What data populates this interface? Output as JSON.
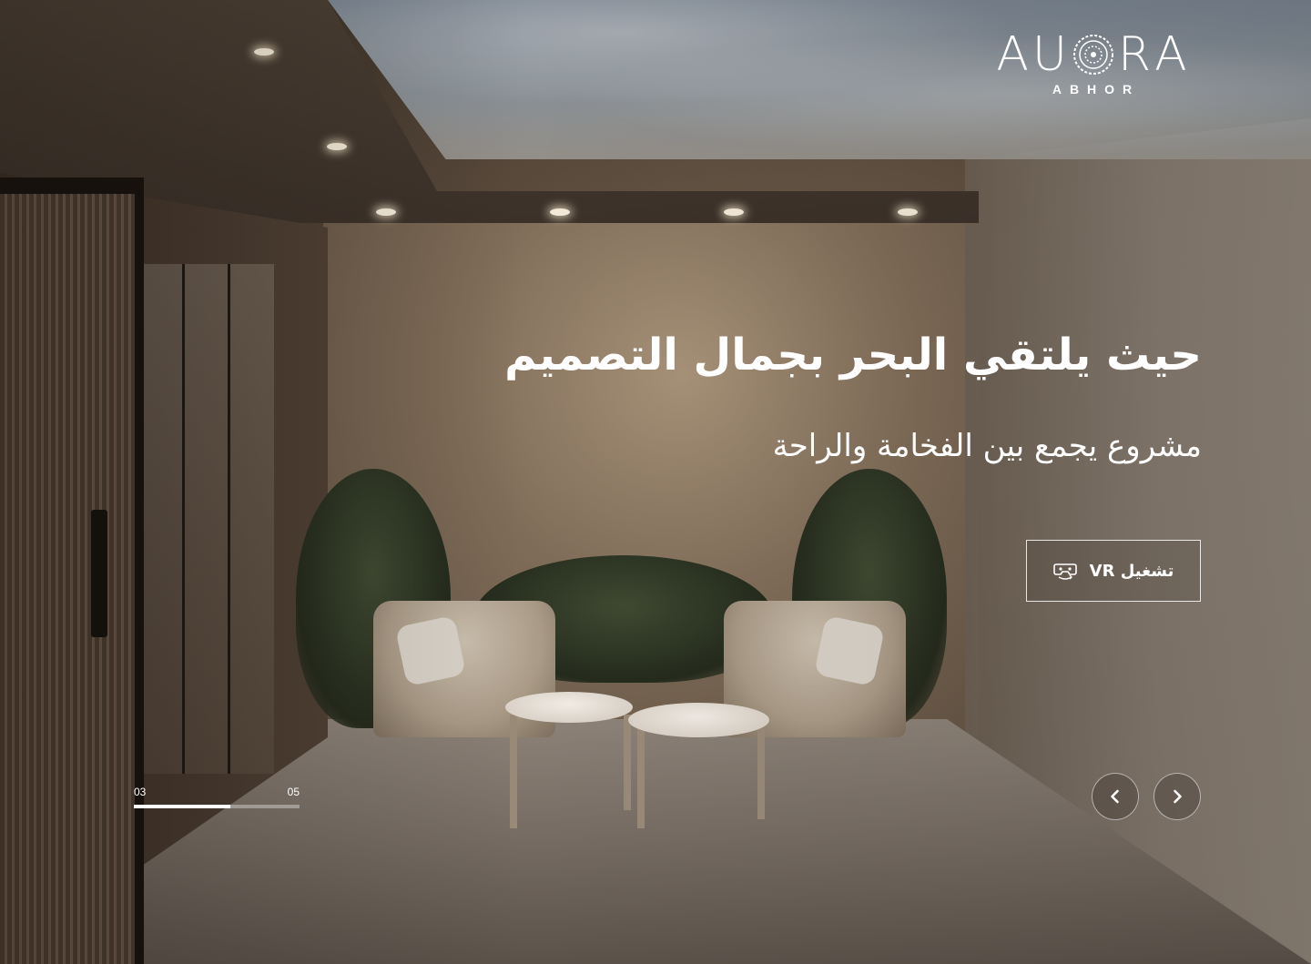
{
  "brand": {
    "logo_letters": [
      "A",
      "U",
      "O",
      "R",
      "A"
    ],
    "logo_subtitle": "ABHOR"
  },
  "hero": {
    "headline": "حيث يلتقي البحر بجمال التصميم",
    "subheadline": "مشروع يجمع بين الفخامة والراحة",
    "vr_button": {
      "label": "تشغيل VR",
      "icon": "vr-headset-icon"
    }
  },
  "slider": {
    "current": "03",
    "total": "05",
    "progress": 0.58,
    "prev_icon": "chevron-left-icon",
    "next_icon": "chevron-right-icon"
  },
  "colors": {
    "text": "#ffffff",
    "overlay": "#2a221c"
  }
}
